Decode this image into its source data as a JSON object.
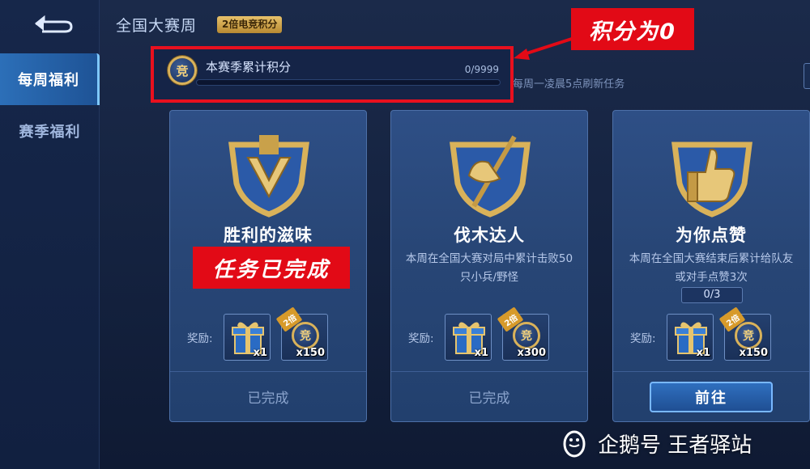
{
  "header": {
    "title": "全国大赛周",
    "badge": "2倍电竞积分",
    "refresh_note": "每周一凌晨5点刷新任务"
  },
  "sidebar": {
    "items": [
      {
        "label": "每周福利",
        "active": true
      },
      {
        "label": "赛季福利",
        "active": false
      }
    ]
  },
  "score": {
    "label": "本赛季累计积分",
    "value_text": "0/9999",
    "coin_glyph": "竞",
    "progress_fraction": 0
  },
  "annotations": {
    "callout": "积分为0",
    "done_stamp": "任务已完成",
    "callout_color": "#e20a16"
  },
  "cards": [
    {
      "title": "胜利的滋味",
      "description": "",
      "progress": "",
      "reward_label": "奖励:",
      "rewards": [
        {
          "icon": "gift-box-icon",
          "qty": "x1",
          "multiplier": ""
        },
        {
          "icon": "competition-coin-icon",
          "qty": "x150",
          "multiplier": "2倍"
        }
      ],
      "status": "已完成",
      "emblem": "victory-emblem-icon"
    },
    {
      "title": "伐木达人",
      "description": "本周在全国大赛对局中累计击败50只小兵/野怪",
      "progress": "",
      "reward_label": "奖励:",
      "rewards": [
        {
          "icon": "gift-box-icon",
          "qty": "x1",
          "multiplier": ""
        },
        {
          "icon": "competition-coin-icon",
          "qty": "x300",
          "multiplier": "2倍"
        }
      ],
      "status": "已完成",
      "emblem": "axe-emblem-icon"
    },
    {
      "title": "为你点赞",
      "description": "本周在全国大赛结束后累计给队友或对手点赞3次",
      "progress": "0/3",
      "reward_label": "奖励:",
      "rewards": [
        {
          "icon": "gift-box-icon",
          "qty": "x1",
          "multiplier": ""
        },
        {
          "icon": "competition-coin-icon",
          "qty": "x150",
          "multiplier": "2倍"
        }
      ],
      "status": "前往",
      "emblem": "thumbs-up-emblem-icon"
    }
  ],
  "watermark": {
    "text": "企鹅号 王者驿站"
  },
  "colors": {
    "accent_blue": "#3fb3ff",
    "gold": "#d9b25a",
    "highlight_red": "#e8101e"
  }
}
